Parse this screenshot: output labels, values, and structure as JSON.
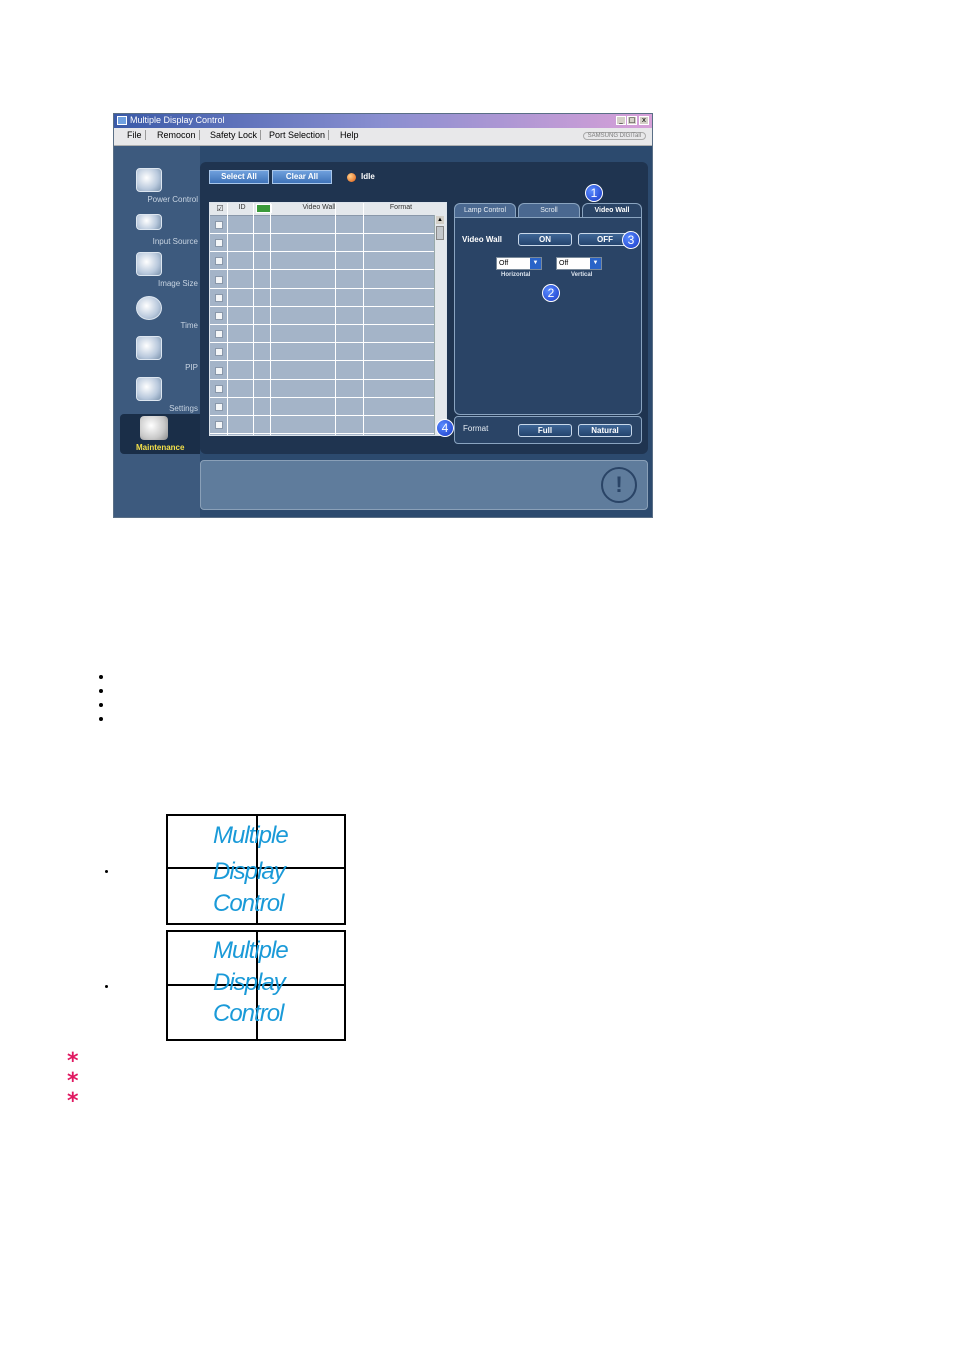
{
  "window": {
    "title": "Multiple Display Control",
    "brand": "SAMSUNG DIGITall",
    "controls": [
      "_",
      "□",
      "x"
    ]
  },
  "menu": [
    "File",
    "Remocon",
    "Safety Lock",
    "Port Selection",
    "Help"
  ],
  "sidebar": {
    "items": [
      {
        "label": "Power Control",
        "icon": "power-control-icon"
      },
      {
        "label": "Input Source",
        "icon": "input-source-icon"
      },
      {
        "label": "Image Size",
        "icon": "image-size-icon"
      },
      {
        "label": "Time",
        "icon": "clock-icon"
      },
      {
        "label": "PIP",
        "icon": "pip-icon"
      },
      {
        "label": "Settings",
        "icon": "settings-icon"
      },
      {
        "label": "Maintenance",
        "icon": "maintenance-icon",
        "selected": true
      }
    ]
  },
  "toolbar": {
    "select_all": "Select All",
    "clear_all": "Clear All",
    "status": "Idle"
  },
  "grid": {
    "columns": [
      "☑",
      "ID",
      "",
      "Video Wall",
      "Format"
    ],
    "row_count": 12
  },
  "tabs": [
    {
      "label": "Lamp Control",
      "active": false
    },
    {
      "label": "Scroll",
      "active": false
    },
    {
      "label": "Video Wall",
      "active": true
    }
  ],
  "video_wall": {
    "label": "Video Wall",
    "on": "ON",
    "off": "OFF",
    "horizontal": {
      "value": "Off",
      "label": "Horizontal"
    },
    "vertical": {
      "value": "Off",
      "label": "Vertical"
    }
  },
  "format": {
    "label": "Format",
    "full": "Full",
    "natural": "Natural"
  },
  "callouts": [
    "1",
    "2",
    "3",
    "4"
  ],
  "illustrations": [
    {
      "lines": [
        "Multiple",
        "Display",
        "Control"
      ]
    },
    {
      "lines": [
        "Multiple",
        "Display",
        "Control"
      ]
    }
  ],
  "colors": {
    "window_bg": "#2c4a6e",
    "accent_blue": "#1a9ad8",
    "note_star": "#e01860",
    "status_idle": "#e05a10"
  }
}
